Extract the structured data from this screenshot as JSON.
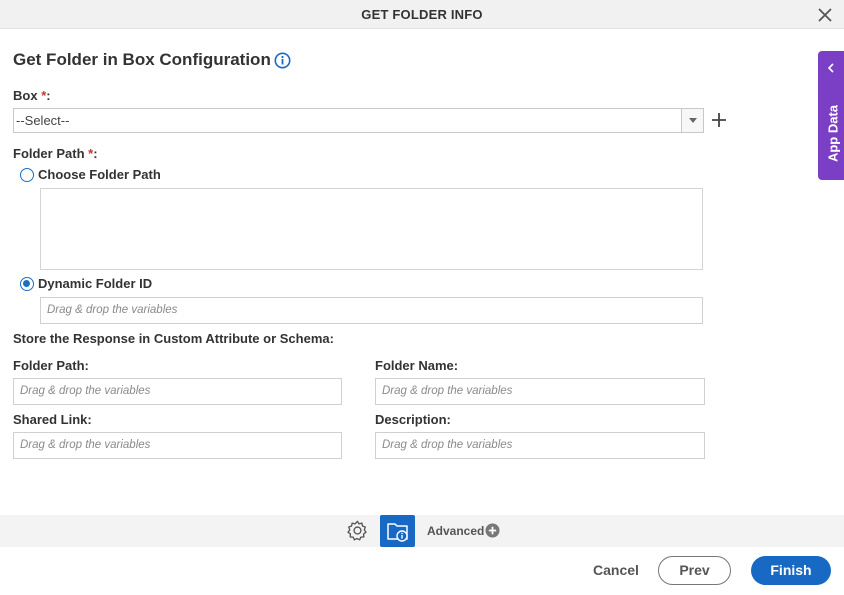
{
  "window": {
    "title": "GET FOLDER INFO"
  },
  "heading": "Get Folder in Box Configuration",
  "box": {
    "label": "Box",
    "required_mark": "*",
    "colon": ":",
    "selected": "--Select--"
  },
  "folder_path": {
    "label": "Folder Path",
    "required_mark": "*",
    "colon": ":",
    "options": [
      {
        "label": "Choose Folder Path",
        "checked": false
      },
      {
        "label": "Dynamic Folder ID",
        "checked": true
      }
    ],
    "dynamic_placeholder": "Drag & drop the variables"
  },
  "store_response": {
    "heading": "Store the Response in Custom Attribute or Schema:",
    "fields": [
      {
        "label": "Folder Path:",
        "placeholder": "Drag & drop the variables"
      },
      {
        "label": "Folder Name:",
        "placeholder": "Drag & drop the variables"
      },
      {
        "label": "Shared Link:",
        "placeholder": "Drag & drop the variables"
      },
      {
        "label": "Description:",
        "placeholder": "Drag & drop the variables"
      }
    ]
  },
  "toolbar": {
    "advanced_label": "Advanced"
  },
  "footer": {
    "cancel": "Cancel",
    "prev": "Prev",
    "finish": "Finish"
  },
  "side_panel": {
    "label": "App Data"
  },
  "colors": {
    "accent": "#1769c4",
    "side_panel": "#7b3fc6",
    "required": "#c0392b"
  },
  "icons": [
    "close-icon",
    "info-icon",
    "plus-icon",
    "gear-icon",
    "folder-info-icon",
    "circle-plus-icon",
    "chevron-left-icon"
  ]
}
